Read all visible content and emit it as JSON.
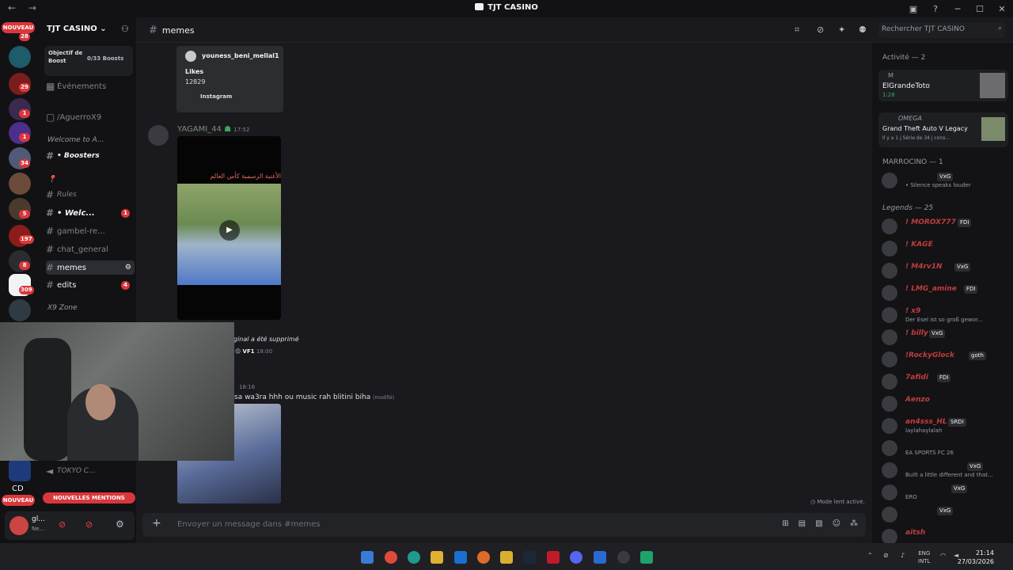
{
  "window": {
    "title": "TJT CASINO",
    "nav": "← →"
  },
  "server": {
    "name": "TJT CASINO",
    "boost_label": "Objectif de Boost",
    "boost_progress": "0/33 Boosts",
    "events": "Événements",
    "vanity": "/AguerroX9"
  },
  "guild_badges": {
    "new": "NOUVEAU",
    "b1": "28",
    "b2": "29",
    "b3": "1",
    "b4": "1",
    "b5": "34",
    "b6": "5",
    "b7": "197",
    "b8": "8",
    "b9": "309"
  },
  "channels": {
    "cat_welcome": "Welcome to A...",
    "boosters": "• Boosters",
    "rules": "Rules",
    "welcome": "• Welc...",
    "welcome_badge": "1",
    "gambel": "gambel-re...",
    "general": "chat_general",
    "memes": "memes",
    "edits": "edits",
    "edits_badge": "4",
    "cat_x9": "X9 Zone",
    "tokyo": "TOKYO C...",
    "new_mentions": "NOUVELLES MENTIONS",
    "new2": "NOUVEAU",
    "cd": "CD"
  },
  "header": {
    "channel": "memes",
    "search_placeholder": "Rechercher TJT CASINO"
  },
  "messages": {
    "embed_user": "youness_beni_mellal1",
    "embed_likes_label": "Likes",
    "embed_likes": "12829",
    "embed_source": "Instagram",
    "author": "YAGAMI_44",
    "time1": "17:52",
    "video_caption": "الأغنية الرسمية كأس العالم",
    "deleted": "ginal a été supprimé",
    "vf_tag": "VF1",
    "time2": "18:00",
    "time3": "18:16",
    "text3": "sa wa3ra hhh ou music rah blitini biha",
    "edited": "(modifié)"
  },
  "composer": {
    "placeholder": "Envoyer un message dans #memes",
    "slow_mode": "Mode lent activé."
  },
  "user_panel": {
    "name": "gl...",
    "status": "Ne..."
  },
  "activity": {
    "header": "Activité — 2",
    "card1_user": "M",
    "card1_title": "ElGrandeToto",
    "card1_time": "1:28",
    "card2_user": "OMEGA",
    "card2_title": "Grand Theft Auto V Legacy",
    "card2_sub": "Il y a 1 j  Série de 34 j cons..."
  },
  "members": {
    "group1": "MARROCINO — 1",
    "m0_tag": "VxG",
    "m0_sub": "• Silence speaks louder",
    "group2": "Legends — 25",
    "list": [
      {
        "name": "! MOROX777",
        "tag": "FDI",
        "sub": ""
      },
      {
        "name": "! KAGE",
        "tag": "",
        "sub": ""
      },
      {
        "name": "! M4rv1N",
        "tag": "VxG",
        "sub": ""
      },
      {
        "name": "! LMG_amine",
        "tag": "FDI",
        "sub": ""
      },
      {
        "name": "! x9",
        "tag": "",
        "sub": "Der Esel ist so groß gewor..."
      },
      {
        "name": "! billy",
        "tag": "VxG",
        "sub": ""
      },
      {
        "name": "!RockyGlock",
        "tag": "goth",
        "sub": ""
      },
      {
        "name": "7afidi",
        "tag": "FDI",
        "sub": ""
      },
      {
        "name": "Aenzo",
        "tag": "",
        "sub": ""
      },
      {
        "name": "an4sss_HL",
        "tag": "SRDI",
        "sub": "laylahaylalah"
      },
      {
        "name": "",
        "tag": "",
        "sub": "EA SPORTS FC 26"
      },
      {
        "name": "",
        "tag": "VxG",
        "sub": "Built a little different and that..."
      },
      {
        "name": "",
        "tag": "VxG",
        "sub": "ERO"
      },
      {
        "name": "",
        "tag": "VxG",
        "sub": ""
      },
      {
        "name": "aitsh",
        "tag": "",
        "sub": ""
      }
    ]
  },
  "taskbar": {
    "lang1": "ENG",
    "lang2": "INTL",
    "time": "21:14",
    "date": "27/03/2026"
  },
  "colors": {
    "accent": "#5865f2",
    "danger": "#da373c",
    "bg": "#1a1a1e"
  }
}
